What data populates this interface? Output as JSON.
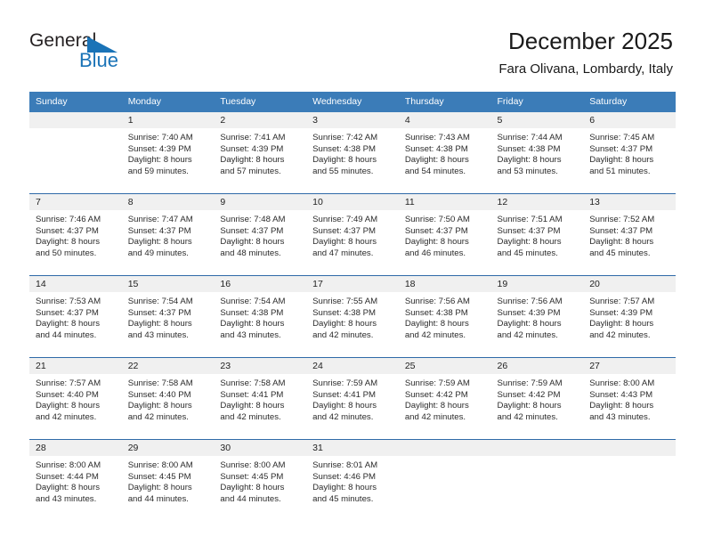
{
  "brand": {
    "name_part1": "General",
    "name_part2": "Blue",
    "accent_color": "#1a73b7"
  },
  "header": {
    "title": "December 2025",
    "subtitle": "Fara Olivana, Lombardy, Italy"
  },
  "theme": {
    "header_row_bg": "#3b7cb8",
    "daynum_band_bg": "#f0f0f0",
    "row_divider": "#2f6aa8"
  },
  "weekday_headers": [
    "Sunday",
    "Monday",
    "Tuesday",
    "Wednesday",
    "Thursday",
    "Friday",
    "Saturday"
  ],
  "weeks": [
    [
      {
        "day": "",
        "empty": true
      },
      {
        "day": "1",
        "sunrise": "Sunrise: 7:40 AM",
        "sunset": "Sunset: 4:39 PM",
        "daylight1": "Daylight: 8 hours",
        "daylight2": "and 59 minutes."
      },
      {
        "day": "2",
        "sunrise": "Sunrise: 7:41 AM",
        "sunset": "Sunset: 4:39 PM",
        "daylight1": "Daylight: 8 hours",
        "daylight2": "and 57 minutes."
      },
      {
        "day": "3",
        "sunrise": "Sunrise: 7:42 AM",
        "sunset": "Sunset: 4:38 PM",
        "daylight1": "Daylight: 8 hours",
        "daylight2": "and 55 minutes."
      },
      {
        "day": "4",
        "sunrise": "Sunrise: 7:43 AM",
        "sunset": "Sunset: 4:38 PM",
        "daylight1": "Daylight: 8 hours",
        "daylight2": "and 54 minutes."
      },
      {
        "day": "5",
        "sunrise": "Sunrise: 7:44 AM",
        "sunset": "Sunset: 4:38 PM",
        "daylight1": "Daylight: 8 hours",
        "daylight2": "and 53 minutes."
      },
      {
        "day": "6",
        "sunrise": "Sunrise: 7:45 AM",
        "sunset": "Sunset: 4:37 PM",
        "daylight1": "Daylight: 8 hours",
        "daylight2": "and 51 minutes."
      }
    ],
    [
      {
        "day": "7",
        "sunrise": "Sunrise: 7:46 AM",
        "sunset": "Sunset: 4:37 PM",
        "daylight1": "Daylight: 8 hours",
        "daylight2": "and 50 minutes."
      },
      {
        "day": "8",
        "sunrise": "Sunrise: 7:47 AM",
        "sunset": "Sunset: 4:37 PM",
        "daylight1": "Daylight: 8 hours",
        "daylight2": "and 49 minutes."
      },
      {
        "day": "9",
        "sunrise": "Sunrise: 7:48 AM",
        "sunset": "Sunset: 4:37 PM",
        "daylight1": "Daylight: 8 hours",
        "daylight2": "and 48 minutes."
      },
      {
        "day": "10",
        "sunrise": "Sunrise: 7:49 AM",
        "sunset": "Sunset: 4:37 PM",
        "daylight1": "Daylight: 8 hours",
        "daylight2": "and 47 minutes."
      },
      {
        "day": "11",
        "sunrise": "Sunrise: 7:50 AM",
        "sunset": "Sunset: 4:37 PM",
        "daylight1": "Daylight: 8 hours",
        "daylight2": "and 46 minutes."
      },
      {
        "day": "12",
        "sunrise": "Sunrise: 7:51 AM",
        "sunset": "Sunset: 4:37 PM",
        "daylight1": "Daylight: 8 hours",
        "daylight2": "and 45 minutes."
      },
      {
        "day": "13",
        "sunrise": "Sunrise: 7:52 AM",
        "sunset": "Sunset: 4:37 PM",
        "daylight1": "Daylight: 8 hours",
        "daylight2": "and 45 minutes."
      }
    ],
    [
      {
        "day": "14",
        "sunrise": "Sunrise: 7:53 AM",
        "sunset": "Sunset: 4:37 PM",
        "daylight1": "Daylight: 8 hours",
        "daylight2": "and 44 minutes."
      },
      {
        "day": "15",
        "sunrise": "Sunrise: 7:54 AM",
        "sunset": "Sunset: 4:37 PM",
        "daylight1": "Daylight: 8 hours",
        "daylight2": "and 43 minutes."
      },
      {
        "day": "16",
        "sunrise": "Sunrise: 7:54 AM",
        "sunset": "Sunset: 4:38 PM",
        "daylight1": "Daylight: 8 hours",
        "daylight2": "and 43 minutes."
      },
      {
        "day": "17",
        "sunrise": "Sunrise: 7:55 AM",
        "sunset": "Sunset: 4:38 PM",
        "daylight1": "Daylight: 8 hours",
        "daylight2": "and 42 minutes."
      },
      {
        "day": "18",
        "sunrise": "Sunrise: 7:56 AM",
        "sunset": "Sunset: 4:38 PM",
        "daylight1": "Daylight: 8 hours",
        "daylight2": "and 42 minutes."
      },
      {
        "day": "19",
        "sunrise": "Sunrise: 7:56 AM",
        "sunset": "Sunset: 4:39 PM",
        "daylight1": "Daylight: 8 hours",
        "daylight2": "and 42 minutes."
      },
      {
        "day": "20",
        "sunrise": "Sunrise: 7:57 AM",
        "sunset": "Sunset: 4:39 PM",
        "daylight1": "Daylight: 8 hours",
        "daylight2": "and 42 minutes."
      }
    ],
    [
      {
        "day": "21",
        "sunrise": "Sunrise: 7:57 AM",
        "sunset": "Sunset: 4:40 PM",
        "daylight1": "Daylight: 8 hours",
        "daylight2": "and 42 minutes."
      },
      {
        "day": "22",
        "sunrise": "Sunrise: 7:58 AM",
        "sunset": "Sunset: 4:40 PM",
        "daylight1": "Daylight: 8 hours",
        "daylight2": "and 42 minutes."
      },
      {
        "day": "23",
        "sunrise": "Sunrise: 7:58 AM",
        "sunset": "Sunset: 4:41 PM",
        "daylight1": "Daylight: 8 hours",
        "daylight2": "and 42 minutes."
      },
      {
        "day": "24",
        "sunrise": "Sunrise: 7:59 AM",
        "sunset": "Sunset: 4:41 PM",
        "daylight1": "Daylight: 8 hours",
        "daylight2": "and 42 minutes."
      },
      {
        "day": "25",
        "sunrise": "Sunrise: 7:59 AM",
        "sunset": "Sunset: 4:42 PM",
        "daylight1": "Daylight: 8 hours",
        "daylight2": "and 42 minutes."
      },
      {
        "day": "26",
        "sunrise": "Sunrise: 7:59 AM",
        "sunset": "Sunset: 4:42 PM",
        "daylight1": "Daylight: 8 hours",
        "daylight2": "and 42 minutes."
      },
      {
        "day": "27",
        "sunrise": "Sunrise: 8:00 AM",
        "sunset": "Sunset: 4:43 PM",
        "daylight1": "Daylight: 8 hours",
        "daylight2": "and 43 minutes."
      }
    ],
    [
      {
        "day": "28",
        "sunrise": "Sunrise: 8:00 AM",
        "sunset": "Sunset: 4:44 PM",
        "daylight1": "Daylight: 8 hours",
        "daylight2": "and 43 minutes."
      },
      {
        "day": "29",
        "sunrise": "Sunrise: 8:00 AM",
        "sunset": "Sunset: 4:45 PM",
        "daylight1": "Daylight: 8 hours",
        "daylight2": "and 44 minutes."
      },
      {
        "day": "30",
        "sunrise": "Sunrise: 8:00 AM",
        "sunset": "Sunset: 4:45 PM",
        "daylight1": "Daylight: 8 hours",
        "daylight2": "and 44 minutes."
      },
      {
        "day": "31",
        "sunrise": "Sunrise: 8:01 AM",
        "sunset": "Sunset: 4:46 PM",
        "daylight1": "Daylight: 8 hours",
        "daylight2": "and 45 minutes."
      },
      {
        "day": "",
        "empty": true
      },
      {
        "day": "",
        "empty": true
      },
      {
        "day": "",
        "empty": true
      }
    ]
  ]
}
